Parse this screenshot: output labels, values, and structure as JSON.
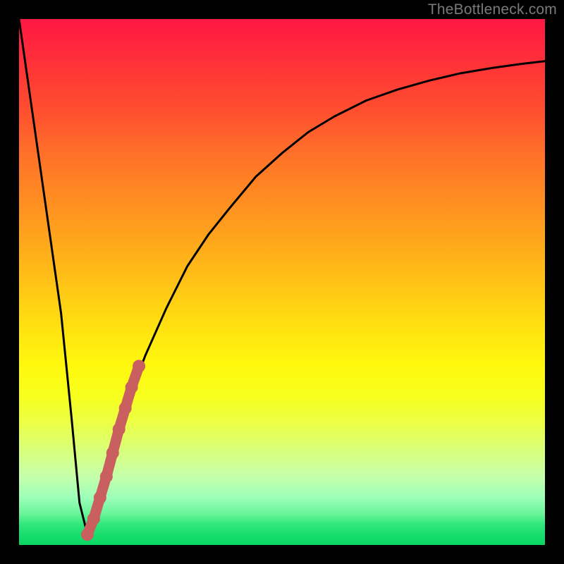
{
  "attribution": "TheBottleneck.com",
  "colors": {
    "curve_stroke": "#000000",
    "accent_dot": "#c9605f",
    "frame": "#000000"
  },
  "chart_data": {
    "type": "line",
    "title": "",
    "xlabel": "",
    "ylabel": "",
    "xlim": [
      0,
      100
    ],
    "ylim": [
      0,
      100
    ],
    "series": [
      {
        "name": "bottleneck-curve",
        "x": [
          0,
          2,
          4,
          6,
          8,
          10,
          11.5,
          13,
          14,
          15,
          17,
          19,
          21,
          24,
          28,
          32,
          36,
          40,
          45,
          50,
          55,
          60,
          66,
          72,
          78,
          84,
          90,
          95,
          100
        ],
        "y": [
          100,
          86,
          72,
          58,
          44,
          24,
          8,
          2,
          4,
          8,
          14,
          21,
          28,
          36,
          45,
          53,
          59,
          64,
          70,
          74.5,
          78.5,
          81.5,
          84.5,
          86.6,
          88.3,
          89.7,
          90.7,
          91.4,
          92
        ]
      },
      {
        "name": "highlighted-segment",
        "x": [
          13,
          14.2,
          15.4,
          16.6,
          17.8,
          19,
          20.2,
          21.4,
          22.8
        ],
        "y": [
          2,
          5,
          9,
          13,
          17.5,
          22,
          26,
          30,
          34
        ]
      }
    ]
  }
}
